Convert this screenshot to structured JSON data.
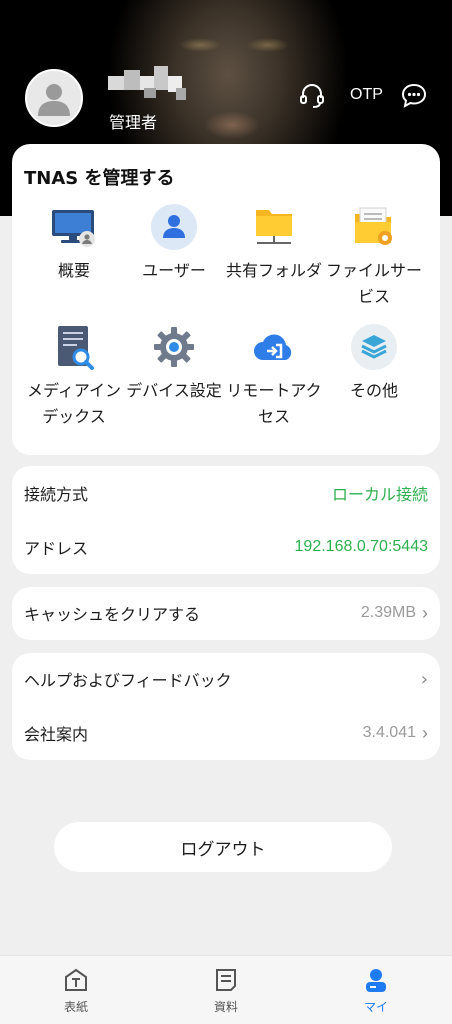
{
  "header": {
    "role": "管理者",
    "otp_label": "OTP",
    "icons": [
      "user-avatar-icon",
      "headset-icon",
      "chat-bubble-icon"
    ]
  },
  "manage": {
    "title": "TNAS を管理する",
    "items": [
      {
        "label": "概要",
        "icon": "monitor-icon"
      },
      {
        "label": "ユーザー",
        "icon": "user-icon"
      },
      {
        "label": "共有フォルダ",
        "icon": "shared-folder-icon"
      },
      {
        "label": "ファイルサービス",
        "icon": "file-service-icon"
      },
      {
        "label": "メディアインデックス",
        "icon": "media-index-icon"
      },
      {
        "label": "デバイス設定",
        "icon": "gear-icon"
      },
      {
        "label": "リモートアクセス",
        "icon": "cloud-access-icon"
      },
      {
        "label": "その他",
        "icon": "layers-icon"
      }
    ]
  },
  "connection": {
    "method_label": "接続方式",
    "method_value": "ローカル接続",
    "address_label": "アドレス",
    "address_value": "192.168.0.70:5443"
  },
  "cache": {
    "label": "キャッシュをクリアする",
    "size": "2.39MB"
  },
  "help": {
    "feedback_label": "ヘルプおよびフィードバック",
    "about_label": "会社案内",
    "version": "3.4.041"
  },
  "logout_label": "ログアウト",
  "tabs": [
    {
      "label": "表紙",
      "icon": "home-t-icon"
    },
    {
      "label": "資料",
      "icon": "document-icon"
    },
    {
      "label": "マイ",
      "icon": "profile-icon"
    }
  ],
  "colors": {
    "accent_green": "#2fb04f",
    "accent_blue": "#1e7bf2",
    "background": "#efefef"
  }
}
